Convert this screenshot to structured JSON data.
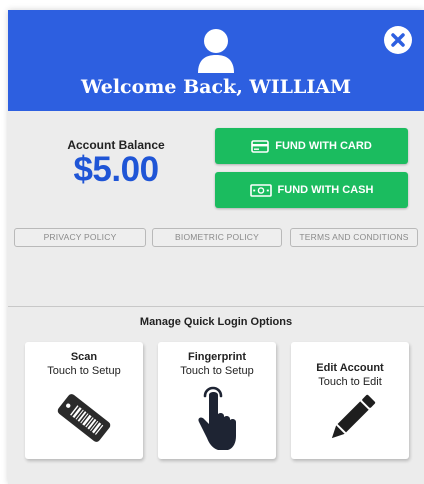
{
  "header": {
    "welcome_prefix": "Welcome Back,",
    "user_name": "WILLIAM",
    "welcome_text": "Welcome Back, WILLIAM",
    "avatar_icon": "user-silhouette-icon",
    "close_icon": "close-icon"
  },
  "balance": {
    "label": "Account Balance",
    "amount": "$5.00"
  },
  "funding": {
    "card_label": "FUND WITH CARD",
    "card_icon": "credit-card-icon",
    "cash_label": "FUND WITH CASH",
    "cash_icon": "banknote-icon",
    "button_color": "#1bbc5f"
  },
  "policies": {
    "privacy": "PRIVACY POLICY",
    "biometric": "BIOMETRIC POLICY",
    "terms": "TERMS AND CONDITIONS"
  },
  "quick_login": {
    "heading": "Manage Quick Login Options",
    "options": [
      {
        "title": "Scan",
        "subtitle": "Touch to Setup",
        "icon": "barcode-card-icon"
      },
      {
        "title": "Fingerprint",
        "subtitle": "Touch to Setup",
        "icon": "touch-finger-icon"
      },
      {
        "title": "Edit Account",
        "subtitle": "Touch to Edit",
        "icon": "pencil-icon"
      }
    ]
  },
  "colors": {
    "header_bg": "#2d5fe0",
    "balance_text": "#1f55d6",
    "panel_bg": "#ececec"
  }
}
